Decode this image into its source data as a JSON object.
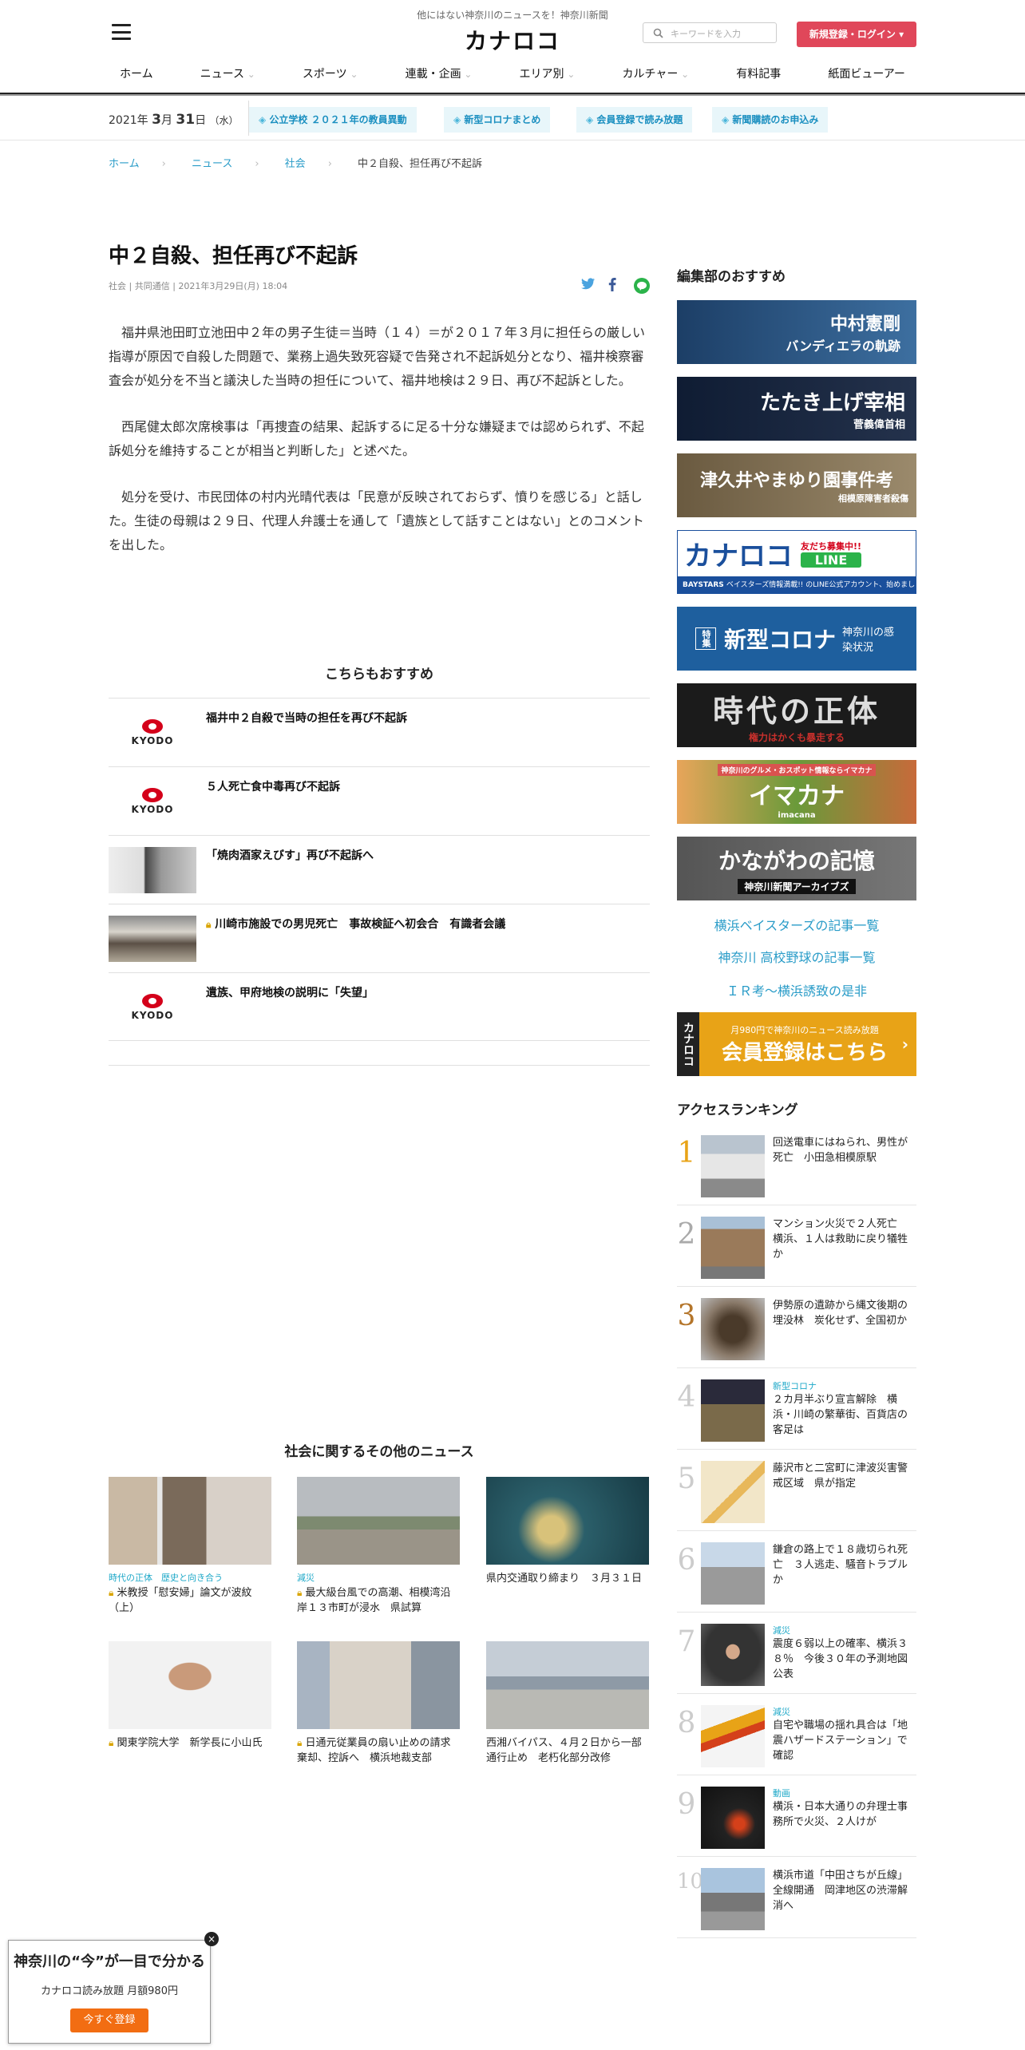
{
  "header": {
    "tagline": "他にはない神奈川のニュースを！神奈川新聞",
    "logo": "カナロコ",
    "search_placeholder": "キーワードを入力",
    "login_label": "新規登録・ログイン",
    "nav": [
      "ホーム",
      "ニュース",
      "スポーツ",
      "連載・企画",
      "エリア別",
      "カルチャー",
      "有料記事",
      "紙面ビューアー"
    ]
  },
  "subbar": {
    "date_year": "2021年",
    "date_month": "3",
    "date_day": "31",
    "date_weekday": "（水）",
    "chips": [
      "公立学校 ２０２１年の教員異動",
      "新型コロナまとめ",
      "会員登録で読み放題",
      "新聞購読のお申込み"
    ]
  },
  "breadcrumb": [
    "ホーム",
    "ニュース",
    "社会",
    "中２自殺、担任再び不起訴"
  ],
  "article": {
    "title": "中２自殺、担任再び不起訴",
    "meta": "社会 | 共同通信 | 2021年3月29日(月) 18:04",
    "paragraphs": [
      "福井県池田町立池田中２年の男子生徒＝当時（１４）＝が２０１７年３月に担任らの厳しい指導が原因で自殺した問題で、業務上過失致死容疑で告発され不起訴処分となり、福井検察審査会が処分を不当と議決した当時の担任について、福井地検は２９日、再び不起訴とした。",
      "西尾健太郎次席検事は「再捜査の結果、起訴するに足る十分な嫌疑までは認められず、不起訴処分を維持することが相当と判断した」と述べた。",
      "処分を受け、市民団体の村内光晴代表は「民意が反映されておらず、憤りを感じる」と話した。生徒の母親は２９日、代理人弁護士を通して「遺族として話すことはない」とのコメントを出した。"
    ]
  },
  "recommend": {
    "heading": "こちらもおすすめ",
    "kyodo_label": "KYODO",
    "items": [
      {
        "title": "福井中２自殺で当時の担任を再び不起訴"
      },
      {
        "title": "５人死亡食中毒再び不起訴"
      },
      {
        "title": "「焼肉酒家えびす」再び不起訴へ"
      },
      {
        "title": "川崎市施設での男児死亡　事故検証へ初会合　有識者会議"
      },
      {
        "title": "遺族、甲府地検の説明に「失望」"
      }
    ]
  },
  "other_news": {
    "heading": "社会に関するその他のニュース",
    "items": [
      {
        "cat": "時代の正体　歴史と向き合う",
        "title": "米教授「慰安婦」論文が波紋（上）"
      },
      {
        "cat": "減災",
        "title": "最大級台風での高潮、相模湾沿岸１３市町が浸水　県試算"
      },
      {
        "cat": "",
        "title": "県内交通取り締まり　３月３１日"
      },
      {
        "cat": "",
        "title": "関東学院大学　新学長に小山氏"
      },
      {
        "cat": "",
        "title": "日通元従業員の扇い止めの請求棄却、控訴へ　横浜地裁支部"
      },
      {
        "cat": "",
        "title": "西湘バイパス、４月２日から一部通行止め　老朽化部分改修"
      }
    ]
  },
  "sidebar": {
    "editor_heading": "編集部のおすすめ",
    "banners": [
      {
        "main": "中村憲剛",
        "sub": "バンディエラの軌跡"
      },
      {
        "main": "たたき上げ宰相",
        "sub": "菅義偉首相"
      },
      {
        "main": "津久井やまゆり園事件考",
        "sub": "相模原障害者殺傷"
      },
      {
        "main": "カナロコ",
        "sub": "ベイスターズ情報満載!! のLINE公式アカウント、始めました。",
        "tag": "友だち募集中!!",
        "tag2": "LINE",
        "tag3": "BAYSTARS"
      },
      {
        "main": "新型コロナ",
        "sub": "神奈川の感染状況",
        "tag": "特集"
      },
      {
        "main": "時代の正体",
        "sub": "権力はかくも暴走する"
      },
      {
        "main": "イマカナ",
        "sub": "神奈川のグルメ・おスポット情報ならイマカナ",
        "tag": "imacana"
      },
      {
        "main": "かながわの記憶",
        "sub": "神奈川新聞アーカイブズ"
      }
    ],
    "links": [
      "横浜ベイスターズの記事一覧",
      "神奈川 高校野球の記事一覧",
      "ＩＲ考～横浜誘致の是非"
    ],
    "member_banner": {
      "small": "月980円で神奈川のニュース読み放題",
      "big": "会員登録はこちら",
      "logo": "カナロコ"
    },
    "ranking_heading": "アクセスランキング",
    "ranking": [
      {
        "n": "1",
        "cat": "",
        "title": "回送電車にはねられ、男性が死亡　小田急相模原駅"
      },
      {
        "n": "2",
        "cat": "",
        "title": "マンション火災で２人死亡　横浜、１人は救助に戻り犠牲か"
      },
      {
        "n": "3",
        "cat": "",
        "title": "伊勢原の遺跡から縄文後期の埋没林　炭化せず、全国初か"
      },
      {
        "n": "4",
        "cat": "新型コロナ",
        "title": "２カ月半ぶり宣言解除　横浜・川崎の繁華街、百貨店の客足は"
      },
      {
        "n": "5",
        "cat": "",
        "title": "藤沢市と二宮町に津波災害警戒区域　県が指定"
      },
      {
        "n": "6",
        "cat": "",
        "title": "鎌倉の路上で１８歳切られ死亡　３人逃走、騒音トラブルか"
      },
      {
        "n": "7",
        "cat": "減災",
        "title": "震度６弱以上の確率、横浜３８％　今後３０年の予測地図公表"
      },
      {
        "n": "8",
        "cat": "減災",
        "title": "自宅や職場の揺れ具合は「地震ハザードステーション」で確認"
      },
      {
        "n": "9",
        "cat": "動画",
        "title": "横浜・日本大通りの弁理士事務所で火災、２人けが"
      },
      {
        "n": "10",
        "cat": "",
        "title": "横浜市道「中田さちが丘線」全線開通　岡津地区の渋滞解消へ"
      }
    ]
  },
  "popup": {
    "heading": "神奈川の“今”が一目で分かる",
    "price": "カナロコ読み放題 月額980円",
    "button": "今すぐ登録",
    "close": "×"
  },
  "colors": {
    "accent": "#e0475a",
    "link": "#2a9cc8",
    "orange": "#f26d12",
    "rank_gold": "#e8a317",
    "rank_bronze": "#b4752a"
  }
}
